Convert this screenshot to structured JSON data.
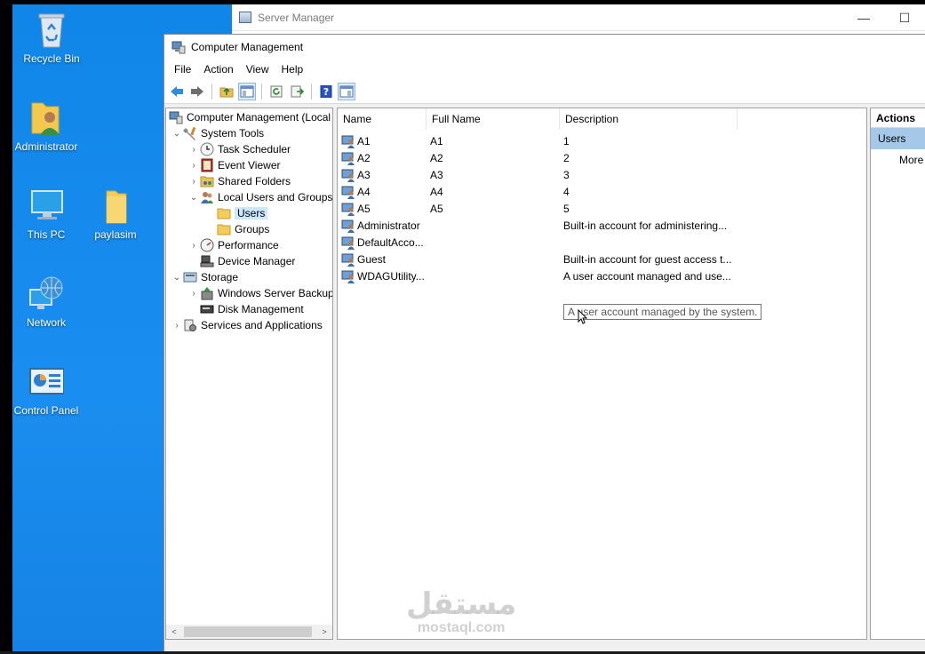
{
  "desktop": {
    "icons": [
      {
        "label": "Recycle Bin",
        "icon": "recycle-bin-icon"
      },
      {
        "label": "Administrator",
        "icon": "user-folder-icon"
      },
      {
        "label": "This PC",
        "icon": "computer-icon"
      },
      {
        "label": "paylasim",
        "icon": "folder-icon"
      },
      {
        "label": "Network",
        "icon": "network-globe-icon"
      },
      {
        "label": "Control Panel",
        "icon": "control-panel-icon"
      }
    ]
  },
  "server_manager": {
    "title": "Server Manager",
    "minimize": "—",
    "maximize": "☐"
  },
  "computer_management": {
    "title": "Computer Management",
    "menu": [
      "File",
      "Action",
      "View",
      "Help"
    ],
    "tree": [
      {
        "label": "Computer Management (Local",
        "arrow": "",
        "icon": "computer-management-icon"
      },
      {
        "label": "System Tools",
        "arrow": "⌄",
        "icon": "tools-icon"
      },
      {
        "label": "Task Scheduler",
        "arrow": "›",
        "icon": "clock-icon"
      },
      {
        "label": "Event Viewer",
        "arrow": "›",
        "icon": "event-viewer-icon"
      },
      {
        "label": "Shared Folders",
        "arrow": "›",
        "icon": "shared-folders-icon"
      },
      {
        "label": "Local Users and Groups",
        "arrow": "⌄",
        "icon": "users-groups-icon"
      },
      {
        "label": "Users",
        "arrow": "",
        "icon": "folder-icon"
      },
      {
        "label": "Groups",
        "arrow": "",
        "icon": "folder-icon"
      },
      {
        "label": "Performance",
        "arrow": "›",
        "icon": "performance-icon"
      },
      {
        "label": "Device Manager",
        "arrow": "",
        "icon": "device-manager-icon"
      },
      {
        "label": "Storage",
        "arrow": "⌄",
        "icon": "storage-icon"
      },
      {
        "label": "Windows Server Backup",
        "arrow": "›",
        "icon": "backup-icon"
      },
      {
        "label": "Disk Management",
        "arrow": "",
        "icon": "disk-icon"
      },
      {
        "label": "Services and Applications",
        "arrow": "›",
        "icon": "services-icon"
      }
    ],
    "scroll_left": "<",
    "scroll_right": ">",
    "columns": [
      "Name",
      "Full Name",
      "Description"
    ],
    "users": [
      {
        "name": "A1",
        "full_name": "A1",
        "description": "1"
      },
      {
        "name": "A2",
        "full_name": "A2",
        "description": "2"
      },
      {
        "name": "A3",
        "full_name": "A3",
        "description": "3"
      },
      {
        "name": "A4",
        "full_name": "A4",
        "description": "4"
      },
      {
        "name": "A5",
        "full_name": "A5",
        "description": "5"
      },
      {
        "name": "Administrator",
        "full_name": "",
        "description": "Built-in account for administering..."
      },
      {
        "name": "DefaultAcco...",
        "full_name": "",
        "description": ""
      },
      {
        "name": "Guest",
        "full_name": "",
        "description": "Built-in account for guest access t..."
      },
      {
        "name": "WDAGUtility...",
        "full_name": "",
        "description": "A user account managed and use..."
      }
    ],
    "tooltip": "A user account managed by the system.",
    "actions": {
      "header": "Actions",
      "section": "Users",
      "more": "More"
    }
  },
  "watermark": {
    "arabic": "مستقل",
    "latin": "mostaql.com"
  }
}
